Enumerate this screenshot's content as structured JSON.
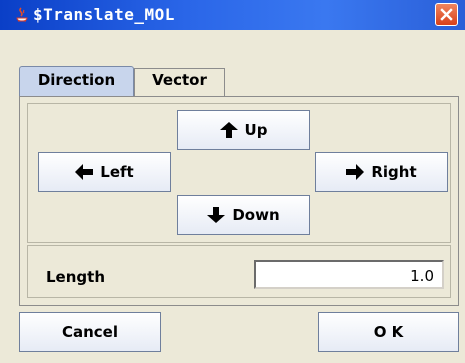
{
  "window": {
    "title": "$Translate_MOL",
    "icons": {
      "app": "java-cup-icon",
      "close": "close-icon"
    }
  },
  "tabs": [
    {
      "label": "Direction",
      "selected": true
    },
    {
      "label": "Vector",
      "selected": false
    }
  ],
  "direction": {
    "up_label": "Up",
    "left_label": "Left",
    "right_label": "Right",
    "down_label": "Down"
  },
  "length": {
    "label": "Length",
    "value": "1.0"
  },
  "footer": {
    "cancel_label": "Cancel",
    "ok_label": "O K"
  },
  "colors": {
    "titlebar": "#2a66e8",
    "selected_tab": "#c8d5ec",
    "window_bg": "#ece9d8",
    "close_button": "#e2542f"
  }
}
